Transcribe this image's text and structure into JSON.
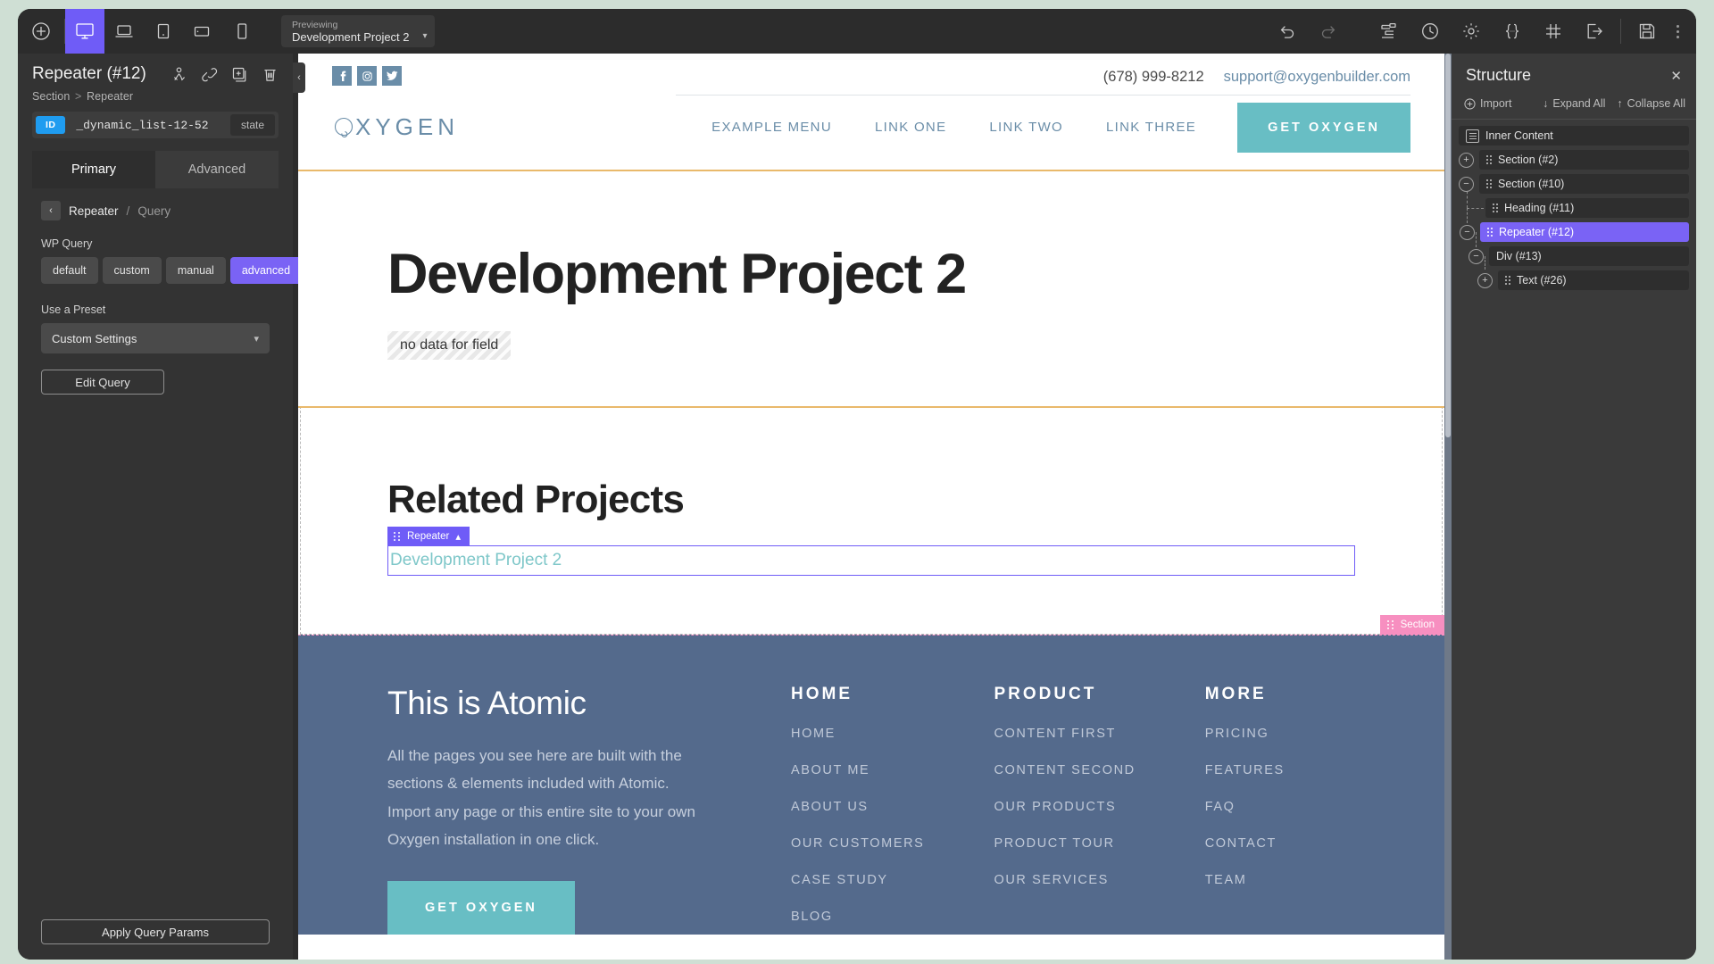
{
  "topbar": {
    "add_label": "add",
    "devices": [
      "desktop",
      "laptop",
      "tablet",
      "tablet-landscape",
      "phone"
    ],
    "active_device": "desktop",
    "previewing_label": "Previewing",
    "previewing_value": "Development Project 2",
    "right_icons": [
      "undo",
      "redo",
      "structure",
      "history",
      "settings",
      "code",
      "grid",
      "exit",
      "save"
    ]
  },
  "left_panel": {
    "title": "Repeater (#12)",
    "breadcrumb_parent": "Section",
    "breadcrumb_sep": ">",
    "breadcrumb_current": "Repeater",
    "actions": [
      "selector-icon",
      "link-icon",
      "duplicate-icon",
      "trash-icon"
    ],
    "id_tag": "ID",
    "id_value": "_dynamic_list-12-52",
    "state_label": "state",
    "tabs": [
      {
        "label": "Primary",
        "active": true
      },
      {
        "label": "Advanced",
        "active": false
      }
    ],
    "sub_breadcrumb": {
      "back": "‹",
      "current": "Repeater",
      "slash": "/",
      "next": "Query"
    },
    "wp_query_label": "WP Query",
    "wp_query_options": [
      {
        "label": "default",
        "active": false
      },
      {
        "label": "custom",
        "active": false
      },
      {
        "label": "manual",
        "active": false
      },
      {
        "label": "advanced",
        "active": true
      }
    ],
    "preset_label": "Use a Preset",
    "preset_value": "Custom Settings",
    "edit_query_label": "Edit Query",
    "apply_label": "Apply Query Params",
    "accent": "#7a63f5",
    "id_tag_color": "#1f9cf0"
  },
  "canvas": {
    "site_header": {
      "social": [
        "facebook",
        "instagram",
        "twitter"
      ],
      "phone": "(678) 999-8212",
      "email": "support@oxygenbuilder.com",
      "logo": "OXYGEN",
      "nav": [
        "EXAMPLE MENU",
        "LINK ONE",
        "LINK TWO",
        "LINK THREE"
      ],
      "cta": "GET OXYGEN"
    },
    "hero": {
      "title": "Development Project 2",
      "no_data_badge": "no data for field"
    },
    "related": {
      "title": "Related Projects",
      "repeater_tag": "Repeater",
      "repeater_item": "Development Project 2"
    },
    "footer": {
      "heading": "This is Atomic",
      "body": "All the pages you see here are built with the sections & elements included with Atomic. Import any page or this entire site to your own Oxygen installation in one click.",
      "cta": "GET OXYGEN",
      "columns": [
        {
          "title": "HOME",
          "links": [
            "HOME",
            "ABOUT ME",
            "ABOUT US",
            "OUR CUSTOMERS",
            "CASE STUDY",
            "BLOG"
          ]
        },
        {
          "title": "PRODUCT",
          "links": [
            "CONTENT FIRST",
            "CONTENT SECOND",
            "OUR PRODUCTS",
            "PRODUCT TOUR",
            "OUR SERVICES"
          ]
        },
        {
          "title": "MORE",
          "links": [
            "PRICING",
            "FEATURES",
            "FAQ",
            "CONTACT",
            "TEAM"
          ]
        }
      ],
      "section_tag": "Section"
    },
    "colors": {
      "teal": "#68bec4",
      "steel_blue": "#6a8da8",
      "footer_bg": "#546a8c",
      "orange_rule": "#e9b96b"
    }
  },
  "structure": {
    "title": "Structure",
    "import_label": "Import",
    "expand_label": "Expand All",
    "collapse_label": "Collapse All",
    "tree": [
      {
        "label": "Inner Content",
        "depth": 0,
        "toggle": "none",
        "icon": "content-icon",
        "selected": false
      },
      {
        "label": "Section (#2)",
        "depth": 0,
        "toggle": "plus",
        "icon": "drag",
        "selected": false
      },
      {
        "label": "Section (#10)",
        "depth": 0,
        "toggle": "minus",
        "icon": "drag",
        "selected": false
      },
      {
        "label": "Heading (#11)",
        "depth": 1,
        "toggle": "none",
        "icon": "drag",
        "selected": false
      },
      {
        "label": "Repeater (#12)",
        "depth": 1,
        "toggle": "minus",
        "icon": "drag",
        "selected": true
      },
      {
        "label": "Div (#13)",
        "depth": 2,
        "toggle": "minus",
        "icon": "none",
        "selected": false
      },
      {
        "label": "Text (#26)",
        "depth": 3,
        "toggle": "plus",
        "icon": "drag",
        "selected": false
      }
    ]
  }
}
